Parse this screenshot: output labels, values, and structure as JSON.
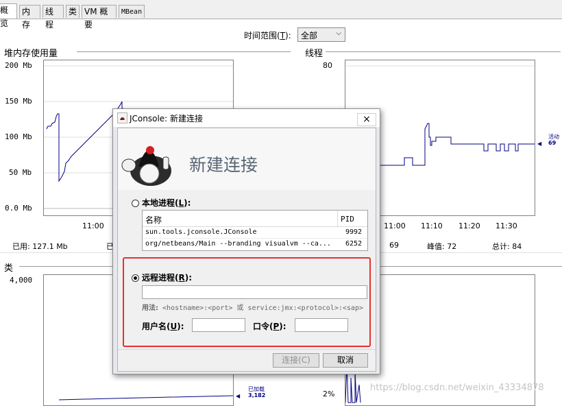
{
  "tabs": [
    "概览",
    "内存",
    "线程",
    "类",
    "VM 概要",
    "MBean"
  ],
  "time_range": {
    "label": "时间范围(",
    "key": "T",
    "label_end": "):",
    "value": "全部"
  },
  "heap": {
    "title": "堆内存使用量",
    "y_ticks": [
      "200 Mb",
      "150 Mb",
      "100 Mb",
      "50 Mb",
      "0.0 Mb"
    ],
    "x_ticks": [
      "11:00"
    ],
    "status_used": "已用:  127.1  Mb",
    "status_cut": "已"
  },
  "threads": {
    "title": "线程",
    "y_ticks": [
      "80"
    ],
    "x_ticks": [
      "11:00",
      "11:10",
      "11:20",
      "11:30"
    ],
    "legend_name": "活动",
    "legend_value": "69",
    "status_live": "69",
    "status_peak": "峰值:  72",
    "status_total": "总计:  84"
  },
  "classes": {
    "title": "类",
    "y_ticks": [
      "4,000"
    ],
    "legend_name": "已加载",
    "legend_value": "3,182"
  },
  "cpu": {
    "y_ticks": [
      "2%"
    ]
  },
  "dialog": {
    "title": "JConsole: 新建连接",
    "close": "×",
    "banner_title": "新建连接",
    "local_label": "本地进程(",
    "local_key": "L",
    "label_end": "):",
    "table_headers": [
      "名称",
      "PID"
    ],
    "processes": [
      {
        "name": "sun.tools.jconsole.JConsole",
        "pid": "9992"
      },
      {
        "name": "org/netbeans/Main --branding visualvm --ca...",
        "pid": "6252"
      }
    ],
    "remote_label": "远程进程(",
    "remote_key": "R",
    "remote_value": "",
    "usage_label": "用法:",
    "usage_text": "<hostname>:<port> 或 service:jmx:<protocol>:<sap>",
    "username_label": "用户名(",
    "username_key": "U",
    "password_label": "口令(",
    "password_key": "P",
    "connect_button": "连接(C)",
    "cancel_button": "取消"
  },
  "watermark": "https://blog.csdn.net/weixin_43334878",
  "colors": {
    "series": "#000080",
    "highlight": "#e53030"
  }
}
